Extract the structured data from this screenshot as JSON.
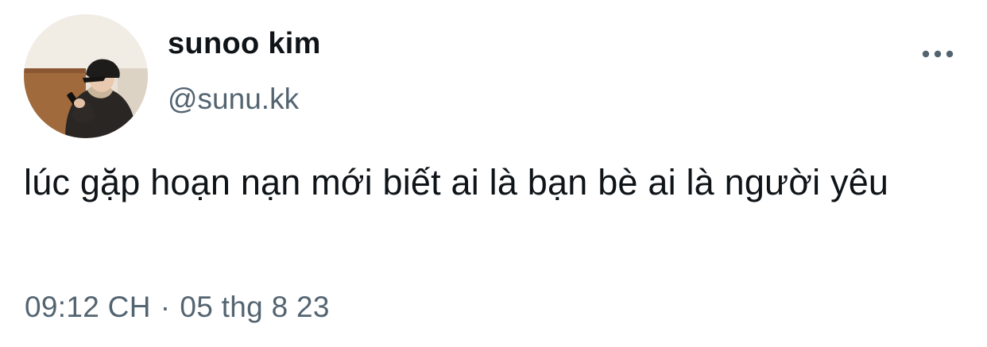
{
  "author": {
    "display_name": "sunoo kim",
    "handle": "@sunu.kk",
    "avatar_icon": "profile-photo"
  },
  "more_icon": "ellipsis-horizontal-icon",
  "tweet": {
    "text": "lúc gặp hoạn nạn mới biết ai là bạn bè ai là người yêu",
    "time": "09:12 CH",
    "separator": "·",
    "date": "05 thg 8 23"
  },
  "colors": {
    "text_primary": "#0f1419",
    "text_secondary": "#536471"
  }
}
